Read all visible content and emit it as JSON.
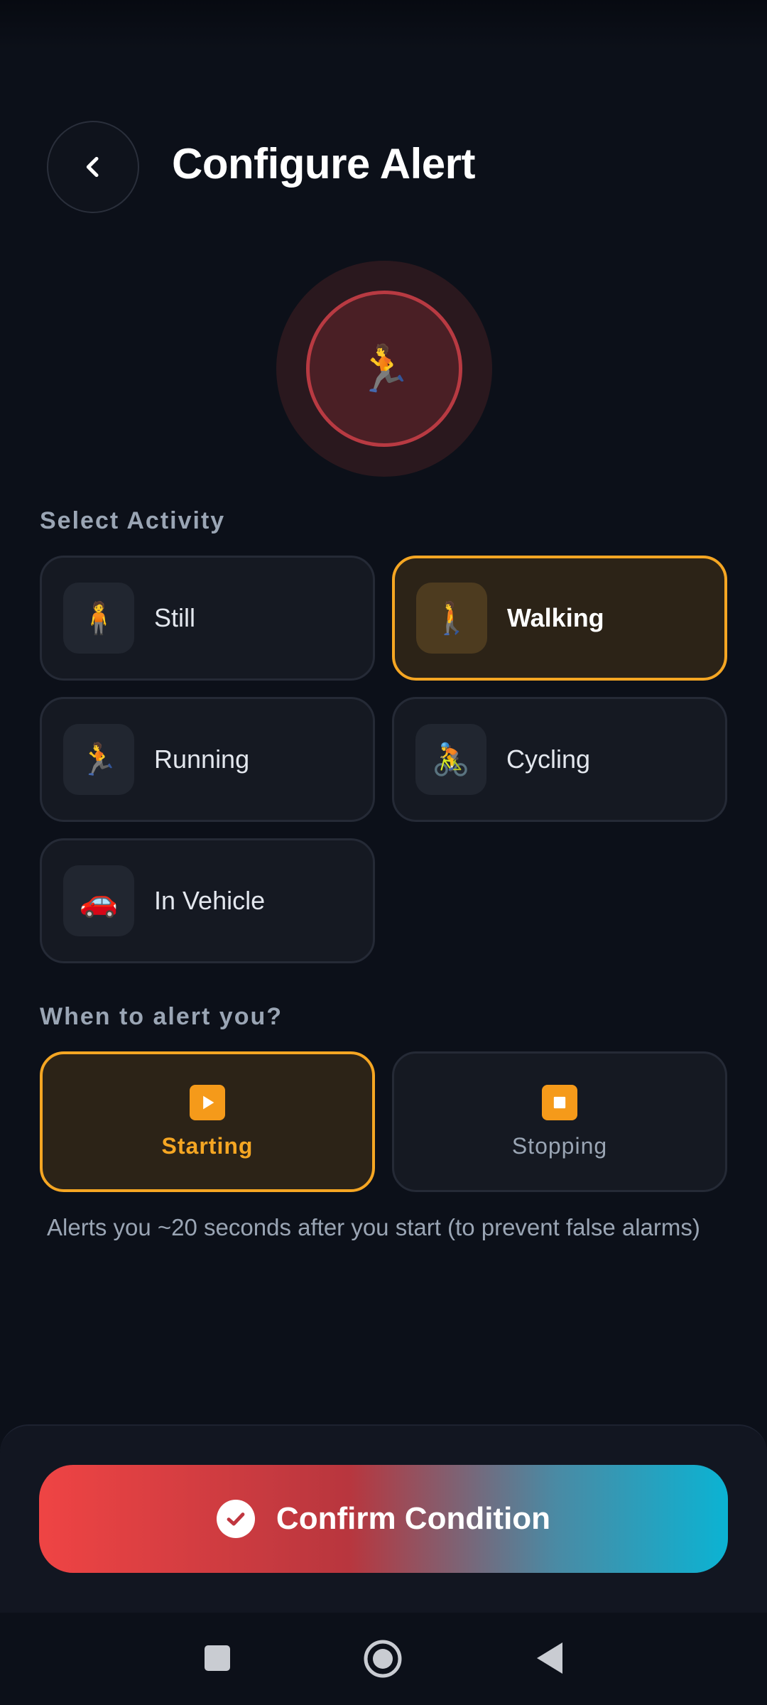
{
  "header": {
    "title": "Configure Alert"
  },
  "hero": {
    "emoji": "🏃"
  },
  "activity_section": {
    "label": "Select Activity",
    "items": [
      {
        "label": "Still",
        "emoji": "🧍",
        "selected": false
      },
      {
        "label": "Walking",
        "emoji": "🚶",
        "selected": true
      },
      {
        "label": "Running",
        "emoji": "🏃",
        "selected": false
      },
      {
        "label": "Cycling",
        "emoji": "🚴",
        "selected": false
      },
      {
        "label": "In Vehicle",
        "emoji": "🚗",
        "selected": false
      }
    ]
  },
  "trigger_section": {
    "label": "When to alert you?",
    "items": [
      {
        "label": "Starting",
        "icon": "play-icon",
        "selected": true
      },
      {
        "label": "Stopping",
        "icon": "stop-icon",
        "selected": false
      }
    ],
    "helper": "Alerts you ~20 seconds after you start (to prevent false alarms)"
  },
  "confirm": {
    "label": "Confirm Condition"
  },
  "colors": {
    "background": "#0c1019",
    "accent": "#f5a623",
    "gradient_start": "#ef4444",
    "gradient_end": "#0bb3d3"
  }
}
